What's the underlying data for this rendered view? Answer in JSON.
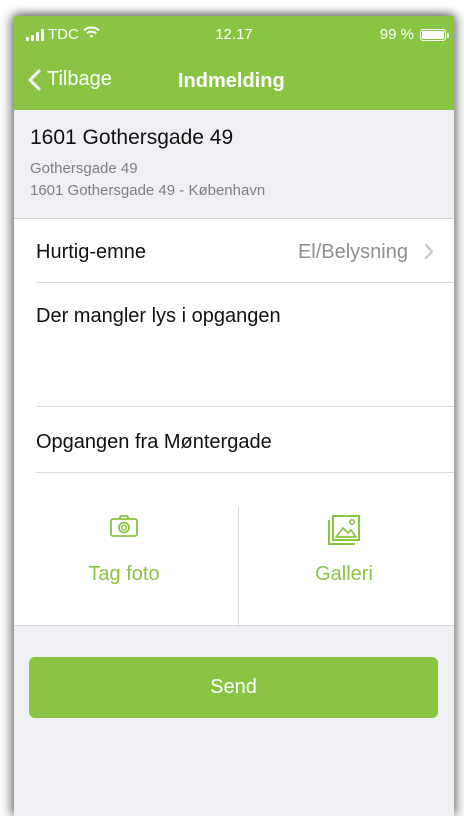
{
  "status_bar": {
    "carrier": "TDC",
    "time": "12.17",
    "battery": "99 %",
    "battery_level": 0.99,
    "icons": [
      "signal-icon",
      "wifi-icon",
      "battery-icon"
    ]
  },
  "nav": {
    "back_label": "Tilbage",
    "title": "Indmelding"
  },
  "address": {
    "line1": "1601 Gothersgade 49",
    "line2": "Gothersgade 49",
    "line3": "1601 Gothersgade 49 - København"
  },
  "form": {
    "topic_label": "Hurtig-emne",
    "topic_value": "El/Belysning",
    "description": "Der mangler lys i opgangen",
    "location": "Opgangen fra Møntergade"
  },
  "media": {
    "photo_label": "Tag foto",
    "gallery_label": "Galleri"
  },
  "send_label": "Send",
  "colors": {
    "accent": "#89c443",
    "background": "#efeff4",
    "secondary_text": "#7f7f83"
  }
}
